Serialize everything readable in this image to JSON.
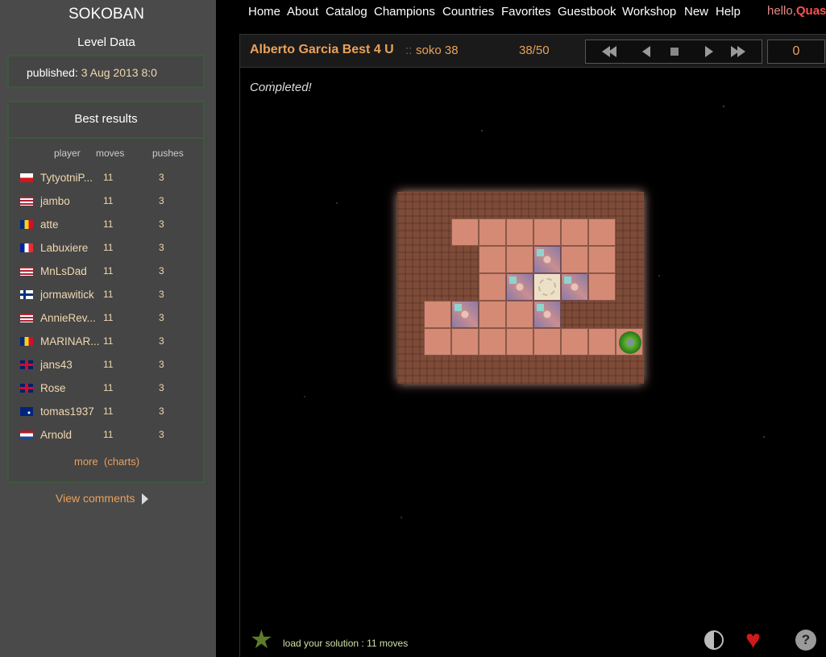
{
  "sidebar": {
    "title": "SOKOBAN",
    "subtitle": "Level Data",
    "published_label": "published:",
    "published_date": "3 Aug 2013 8:0",
    "best_results_title": "Best results",
    "columns": {
      "player": "player",
      "moves": "moves",
      "pushes": "pushes"
    },
    "results": [
      {
        "player": "TytyotniP...",
        "moves": "11",
        "pushes": "3",
        "flag": "flag-cz-icon"
      },
      {
        "player": "jambo",
        "moves": "11",
        "pushes": "3",
        "flag": "flag-us-icon"
      },
      {
        "player": "atte",
        "moves": "11",
        "pushes": "3",
        "flag": "flag-ro-icon"
      },
      {
        "player": "Labuxiere",
        "moves": "11",
        "pushes": "3",
        "flag": "flag-fr-icon"
      },
      {
        "player": "MnLsDad",
        "moves": "11",
        "pushes": "3",
        "flag": "flag-us-icon"
      },
      {
        "player": "jormawitick",
        "moves": "11",
        "pushes": "3",
        "flag": "flag-fi-icon"
      },
      {
        "player": "AnnieRev...",
        "moves": "11",
        "pushes": "3",
        "flag": "flag-us-icon"
      },
      {
        "player": "MARINAR...",
        "moves": "11",
        "pushes": "3",
        "flag": "flag-ro-icon"
      },
      {
        "player": "jans43",
        "moves": "11",
        "pushes": "3",
        "flag": "flag-gb-icon"
      },
      {
        "player": "Rose",
        "moves": "11",
        "pushes": "3",
        "flag": "flag-gb-icon"
      },
      {
        "player": "tomas1937",
        "moves": "11",
        "pushes": "3",
        "flag": "flag-au-icon"
      },
      {
        "player": "Arnold",
        "moves": "11",
        "pushes": "3",
        "flag": "flag-nl-icon"
      }
    ],
    "more_label": "more",
    "charts_label": "(charts)",
    "view_comments_label": "View comments"
  },
  "nav": {
    "items": [
      "Home",
      "About",
      "Catalog",
      "Champions",
      "Countries",
      "Favorites",
      "Guestbook",
      "Workshop",
      "New",
      "Help"
    ],
    "greeting": "hello,",
    "user": "Quas"
  },
  "toolbar": {
    "collection": "Alberto Garcia Best 4 U",
    "separator": "::",
    "level_name": "soko 38",
    "progress": "38/50",
    "move_counter": "0"
  },
  "game": {
    "status": "Completed!"
  },
  "footer": {
    "load_solution": "load your solution : 11 moves"
  },
  "colors": {
    "accent": "#e9a15a",
    "sidebar_bg": "#4a4a4a",
    "greeting": "#e38a8a"
  }
}
